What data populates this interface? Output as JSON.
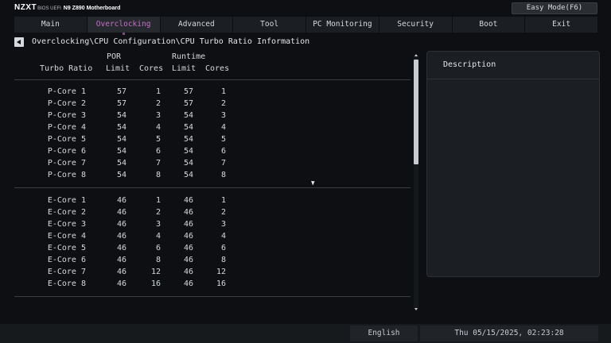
{
  "brand": {
    "logo": "NZXT",
    "bios": "BIOS UEFI",
    "model": "N9 Z890 Motherboard"
  },
  "easy_mode_label": "Easy Mode(F6)",
  "tabs": [
    "Main",
    "Overclocking",
    "Advanced",
    "Tool",
    "PC Monitoring",
    "Security",
    "Boot",
    "Exit"
  ],
  "active_tab": "Overclocking",
  "breadcrumb": "Overclocking\\CPU Configuration\\CPU Turbo Ratio Information",
  "table": {
    "headers": {
      "turbo_ratio": "Turbo Ratio",
      "por": "POR",
      "runtime": "Runtime",
      "limit": "Limit",
      "cores": "Cores"
    },
    "p_cores": [
      {
        "name": "P-Core 1",
        "por_limit": "57",
        "por_cores": "1",
        "rt_limit": "57",
        "rt_cores": "1"
      },
      {
        "name": "P-Core 2",
        "por_limit": "57",
        "por_cores": "2",
        "rt_limit": "57",
        "rt_cores": "2"
      },
      {
        "name": "P-Core 3",
        "por_limit": "54",
        "por_cores": "3",
        "rt_limit": "54",
        "rt_cores": "3"
      },
      {
        "name": "P-Core 4",
        "por_limit": "54",
        "por_cores": "4",
        "rt_limit": "54",
        "rt_cores": "4"
      },
      {
        "name": "P-Core 5",
        "por_limit": "54",
        "por_cores": "5",
        "rt_limit": "54",
        "rt_cores": "5"
      },
      {
        "name": "P-Core 6",
        "por_limit": "54",
        "por_cores": "6",
        "rt_limit": "54",
        "rt_cores": "6"
      },
      {
        "name": "P-Core 7",
        "por_limit": "54",
        "por_cores": "7",
        "rt_limit": "54",
        "rt_cores": "7"
      },
      {
        "name": "P-Core 8",
        "por_limit": "54",
        "por_cores": "8",
        "rt_limit": "54",
        "rt_cores": "8"
      }
    ],
    "e_cores": [
      {
        "name": "E-Core 1",
        "por_limit": "46",
        "por_cores": "1",
        "rt_limit": "46",
        "rt_cores": "1"
      },
      {
        "name": "E-Core 2",
        "por_limit": "46",
        "por_cores": "2",
        "rt_limit": "46",
        "rt_cores": "2"
      },
      {
        "name": "E-Core 3",
        "por_limit": "46",
        "por_cores": "3",
        "rt_limit": "46",
        "rt_cores": "3"
      },
      {
        "name": "E-Core 4",
        "por_limit": "46",
        "por_cores": "4",
        "rt_limit": "46",
        "rt_cores": "4"
      },
      {
        "name": "E-Core 5",
        "por_limit": "46",
        "por_cores": "6",
        "rt_limit": "46",
        "rt_cores": "6"
      },
      {
        "name": "E-Core 6",
        "por_limit": "46",
        "por_cores": "8",
        "rt_limit": "46",
        "rt_cores": "8"
      },
      {
        "name": "E-Core 7",
        "por_limit": "46",
        "por_cores": "12",
        "rt_limit": "46",
        "rt_cores": "12"
      },
      {
        "name": "E-Core 8",
        "por_limit": "46",
        "por_cores": "16",
        "rt_limit": "46",
        "rt_cores": "16"
      }
    ]
  },
  "description": {
    "title": "Description"
  },
  "footer": {
    "language": "English",
    "datetime": "Thu 05/15/2025, 02:23:28"
  },
  "colors": {
    "accent": "#c66fc9",
    "background": "#0d0f12",
    "tab_bg": "#1b1e22"
  },
  "icons": {
    "back": "back-arrow-icon",
    "cursor": "mouse-cursor-icon"
  }
}
